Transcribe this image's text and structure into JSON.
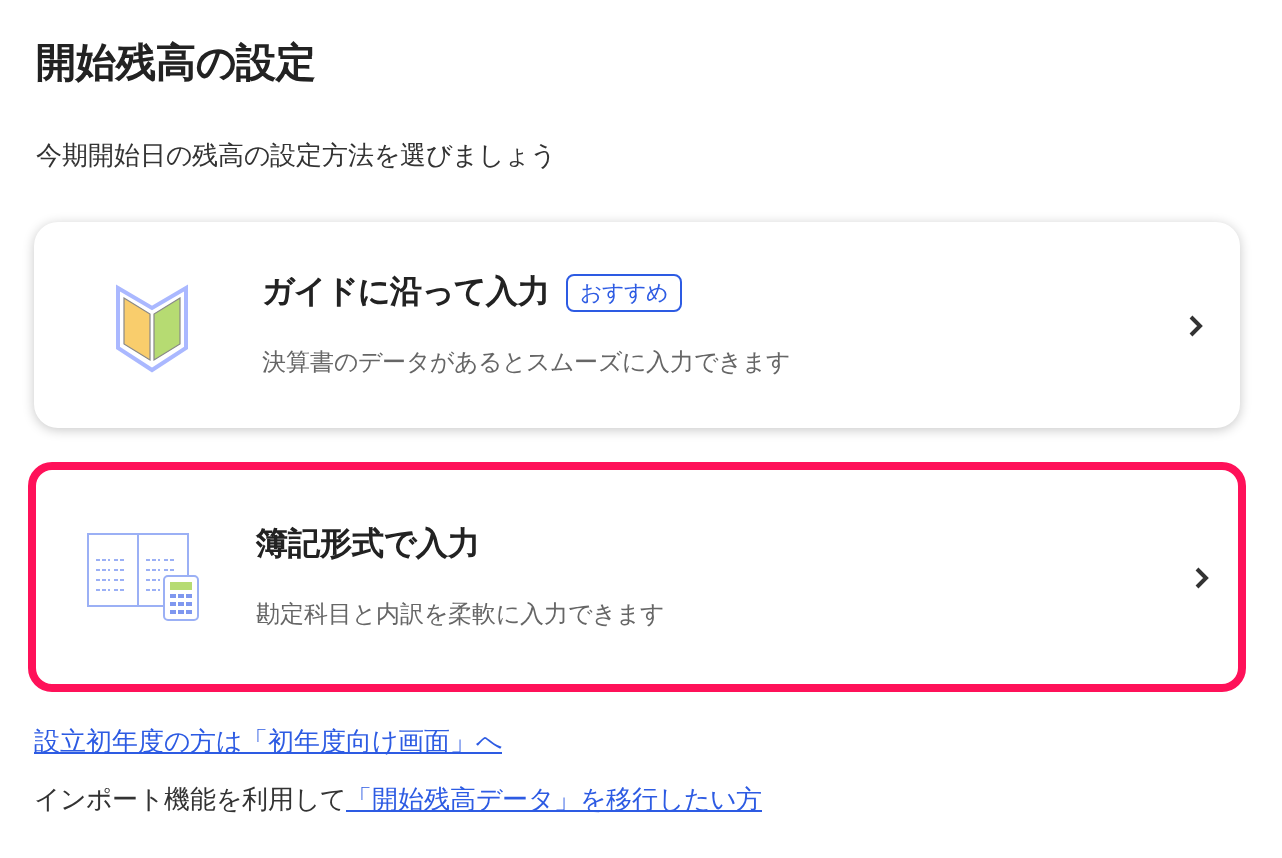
{
  "title": "開始残高の設定",
  "subtitle": "今期開始日の残高の設定方法を選びましょう",
  "options": [
    {
      "kind": "guide",
      "title": "ガイドに沿って入力",
      "badge": "おすすめ",
      "description": "決算書のデータがあるとスムーズに入力できます",
      "selected": false
    },
    {
      "kind": "ledger",
      "title": "簿記形式で入力",
      "description": "勘定科目と内訳を柔軟に入力できます",
      "selected": true
    }
  ],
  "links": [
    {
      "link": "設立初年度の方は「初年度向け画面」へ"
    },
    {
      "text": "インポート機能を利用して",
      "link": "「開始残高データ」を移行したい方"
    }
  ]
}
